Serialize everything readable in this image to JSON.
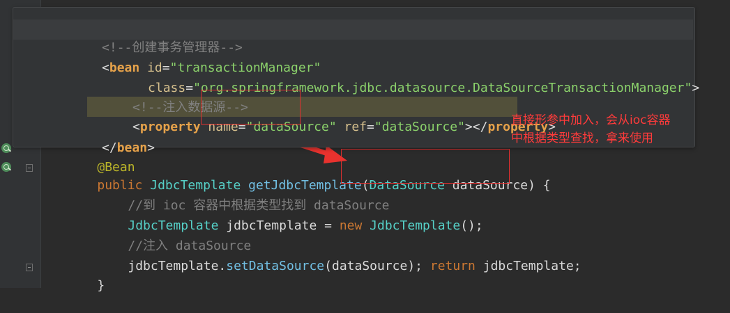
{
  "colors": {
    "background": "#2b2b2b",
    "keyword": "#cc7832",
    "class": "#56d1c8",
    "comment": "#808080",
    "xml_tag": "#e6a24a",
    "xml_string": "#8bd16b",
    "annotation_text": "#ff3b3b",
    "highlight_box": "#e23030"
  },
  "icons": [
    "fold-marker-icon",
    "bean-gutter-icon"
  ],
  "popup": {
    "comment1": "<!--创建事务管理器-->",
    "bean_open_lt": "<",
    "bean_tag": "bean",
    "id_attr": "id",
    "eq": "=",
    "id_value": "\"transactionManager\"",
    "class_attr": "class",
    "class_value": "\"org.springframework.jdbc.datasource.DataSourceTransactionManager\"",
    "bean_open_gt": ">",
    "comment2": "<!--注入数据源-->",
    "prop_lt": "<",
    "prop_tag": "property",
    "name_attr": "name",
    "name_value": "\"dataSource\"",
    "ref_attr": "ref",
    "ref_value": "\"dataSource\"",
    "prop_close_open": "></",
    "prop_close_tag": "property",
    "prop_close_gt": ">",
    "bean_close_lt": "</",
    "bean_close_tag": "bean",
    "bean_close_gt": ">"
  },
  "code": {
    "annotation": "@Bean",
    "public_kw": "public",
    "return_type": "JdbcTemplate",
    "method_name": "getJdbcTemplate",
    "paren_open": "(",
    "param_type": "DataSource",
    "param_name": "dataSource",
    "paren_close_brace": ") {",
    "comment1": "//到 ioc 容器中根据类型找到 dataSource",
    "var_type": "JdbcTemplate",
    "var_decl": "jdbcTemplate = ",
    "new_kw": "new",
    "ctor": "JdbcTemplate",
    "ctor_end": "();",
    "comment2": "//注入 dataSource",
    "call_obj": "jdbcTemplate.",
    "call_method": "setDataSource",
    "call_args": "(dataSource); ",
    "return_kw": "return",
    "return_val": "jdbcTemplate;",
    "close_brace": "}"
  },
  "annotation_note": {
    "line1": "直接形参中加入，会从ioc容器",
    "line2": "中根据类型查找，拿来使用"
  }
}
